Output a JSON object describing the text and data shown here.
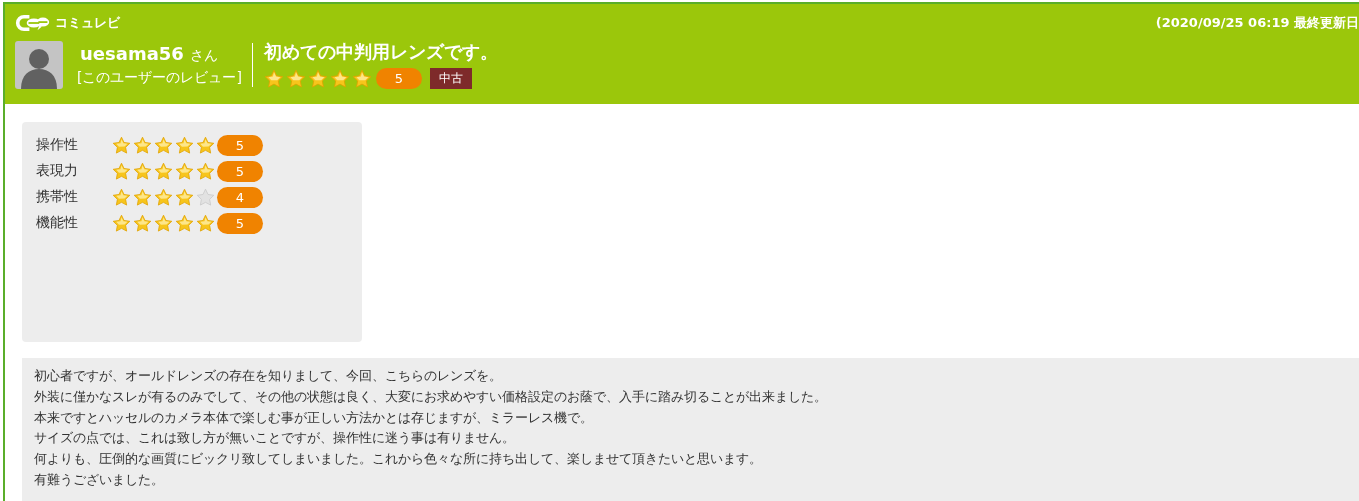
{
  "brand": "コミュレビ",
  "updated": "(2020/09/25 06:19 最終更新日",
  "user": {
    "name": "uesama56",
    "suffix": "さん",
    "link": "[このユーザーのレビュー]"
  },
  "review": {
    "title": "初めての中判用レンズです。",
    "stars": 5,
    "score": "5",
    "tag": "中古"
  },
  "ratings": [
    {
      "label": "操作性",
      "stars": 5,
      "score": "5"
    },
    {
      "label": "表現力",
      "stars": 5,
      "score": "5"
    },
    {
      "label": "携帯性",
      "stars": 4,
      "score": "4"
    },
    {
      "label": "機能性",
      "stars": 5,
      "score": "5"
    }
  ],
  "comment": [
    "初心者ですが、オールドレンズの存在を知りまして、今回、こちらのレンズを。",
    "外装に僅かなスレが有るのみでして、その他の状態は良く、大変にお求めやすい価格設定のお蔭で、入手に踏み切ることが出来ました。",
    "本来ですとハッセルのカメラ本体で楽しむ事が正しい方法かとは存じますが、ミラーレス機で。",
    "サイズの点では、これは致し方が無いことですが、操作性に迷う事は有りません。",
    "何よりも、圧倒的な画質にビックリ致してしまいました。これから色々な所に持ち出して、楽しませて頂きたいと思います。",
    "有難うございました。"
  ]
}
